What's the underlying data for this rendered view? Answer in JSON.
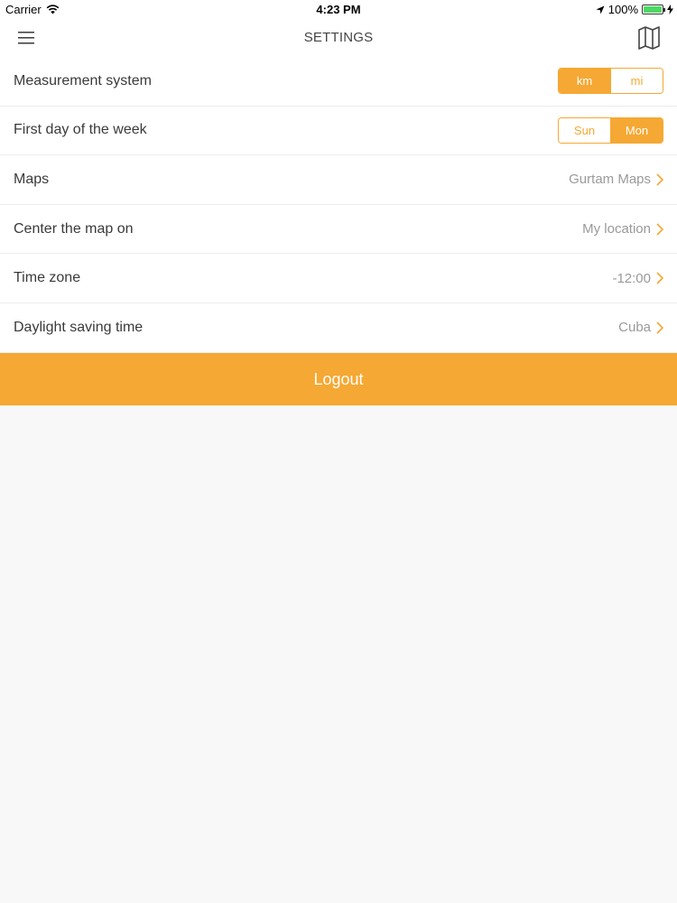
{
  "status_bar": {
    "carrier": "Carrier",
    "time": "4:23 PM",
    "battery": "100%",
    "battery_level": 1.0
  },
  "header": {
    "title": "SETTINGS",
    "left_icon": "menu-icon",
    "right_icon": "map-icon"
  },
  "settings": {
    "measurement": {
      "label": "Measurement system",
      "options": [
        "km",
        "mi"
      ],
      "selected": "km"
    },
    "first_day": {
      "label": "First day of the week",
      "options": [
        "Sun",
        "Mon"
      ],
      "selected": "Mon"
    },
    "maps": {
      "label": "Maps",
      "value": "Gurtam Maps"
    },
    "center_map": {
      "label": "Center the map on",
      "value": "My location"
    },
    "time_zone": {
      "label": "Time zone",
      "value": "-12:00"
    },
    "dst": {
      "label": "Daylight saving time",
      "value": "Cuba"
    }
  },
  "logout": {
    "label": "Logout"
  },
  "colors": {
    "accent": "#f5a833",
    "background": "#f8f8f8",
    "value_text": "#9a9a9a"
  }
}
